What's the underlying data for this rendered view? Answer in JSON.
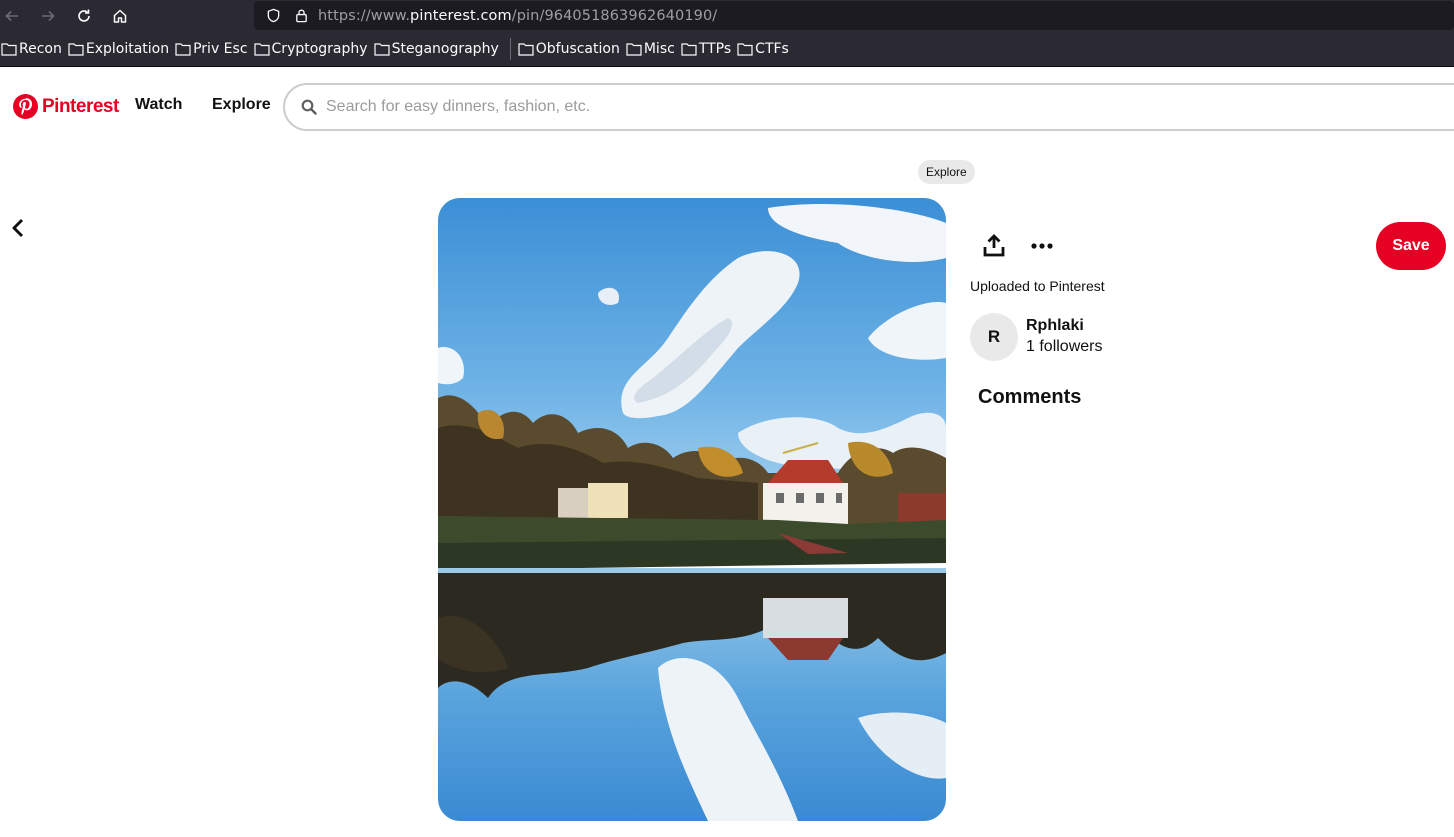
{
  "browser": {
    "url_prefix": "https://www.",
    "url_host": "pinterest.com",
    "url_path": "/pin/964051863962640190/",
    "bookmarks": [
      "Recon",
      "Exploitation",
      "Priv Esc",
      "Cryptography",
      "Steganography",
      "Obfuscation",
      "Misc",
      "TTPs",
      "CTFs"
    ]
  },
  "header": {
    "logo_text": "Pinterest",
    "nav_watch": "Watch",
    "nav_explore": "Explore",
    "search_placeholder": "Search for easy dinners, fashion, etc.",
    "brand_color": "#e60023"
  },
  "pin": {
    "explore_tag": "Explore",
    "save_label": "Save",
    "uploaded_text": "Uploaded to Pinterest",
    "user": {
      "initial": "R",
      "name": "Rphlaki",
      "followers": "1 followers"
    },
    "comments_heading": "Comments"
  },
  "icons": {
    "back": "back-arrow-icon",
    "forward": "forward-arrow-icon",
    "reload": "reload-icon",
    "home": "home-icon",
    "shield": "shield-icon",
    "lock": "lock-icon",
    "folder": "folder-icon",
    "search": "search-icon",
    "chevron_left": "chevron-left-icon",
    "share": "share-icon",
    "more": "more-dots-icon"
  }
}
